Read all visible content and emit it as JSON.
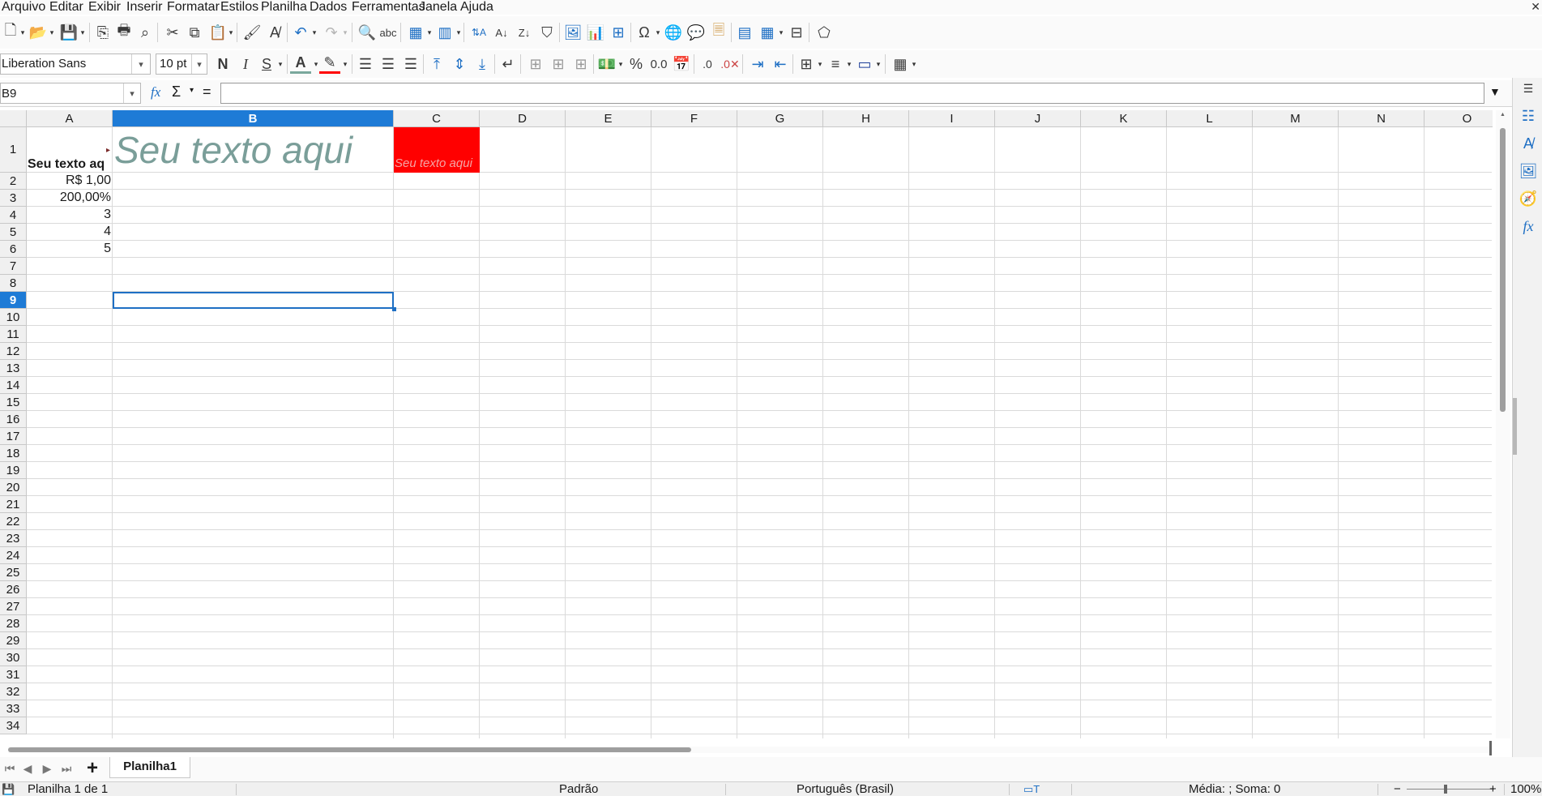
{
  "menu": [
    "Arquivo",
    "Editar",
    "Exibir",
    "Inserir",
    "Formatar",
    "Estilos",
    "Planilha",
    "Dados",
    "Ferramentas",
    "Janela",
    "Ajuda"
  ],
  "menu_underline": [
    "A",
    "E",
    "x",
    "I",
    "F",
    "s",
    "P",
    "D",
    "r",
    "J",
    "u"
  ],
  "font": {
    "name": "Liberation Sans",
    "size": "10 pt"
  },
  "format_buttons": {
    "bold": "N",
    "italic": "I",
    "underline": "S"
  },
  "namebox": "B9",
  "formula_labels": {
    "sum": "Σ",
    "equals": "="
  },
  "columns": [
    "A",
    "B",
    "C",
    "D",
    "E",
    "F",
    "G",
    "H",
    "I",
    "J",
    "K",
    "L",
    "M",
    "N",
    "O"
  ],
  "selected_column": "B",
  "rows": [
    "1",
    "2",
    "3",
    "4",
    "5",
    "6",
    "7",
    "8",
    "9",
    "10",
    "11",
    "12",
    "13",
    "14",
    "15",
    "16",
    "17",
    "18",
    "19",
    "20",
    "21",
    "22",
    "23",
    "24",
    "25",
    "26",
    "27",
    "28",
    "29",
    "30",
    "31",
    "32",
    "33",
    "34"
  ],
  "selected_row": "9",
  "cells": {
    "A1": "Seu texto aq",
    "B1": "Seu texto aqui",
    "C1": "Seu texto aqui",
    "A2": "R$ 1,00",
    "A3": "200,00%",
    "A4": "3",
    "A5": "4",
    "A6": "5"
  },
  "colors": {
    "accent": "#1e7bd6",
    "b1_text": "#7a9e99",
    "c1_fill": "#ff0000",
    "c1_text": "#f5a3a3"
  },
  "sheet_tab": "Planilha1",
  "add_sheet": "+",
  "status": {
    "sheet": "Planilha 1 de 1",
    "style": "Padrão",
    "language": "Português (Brasil)",
    "summary": "Média: ; Soma: 0",
    "zoom": "100%"
  },
  "sidebar_icons": [
    "properties-icon",
    "styles-icon",
    "gallery-icon",
    "navigator-icon",
    "functions-icon"
  ]
}
